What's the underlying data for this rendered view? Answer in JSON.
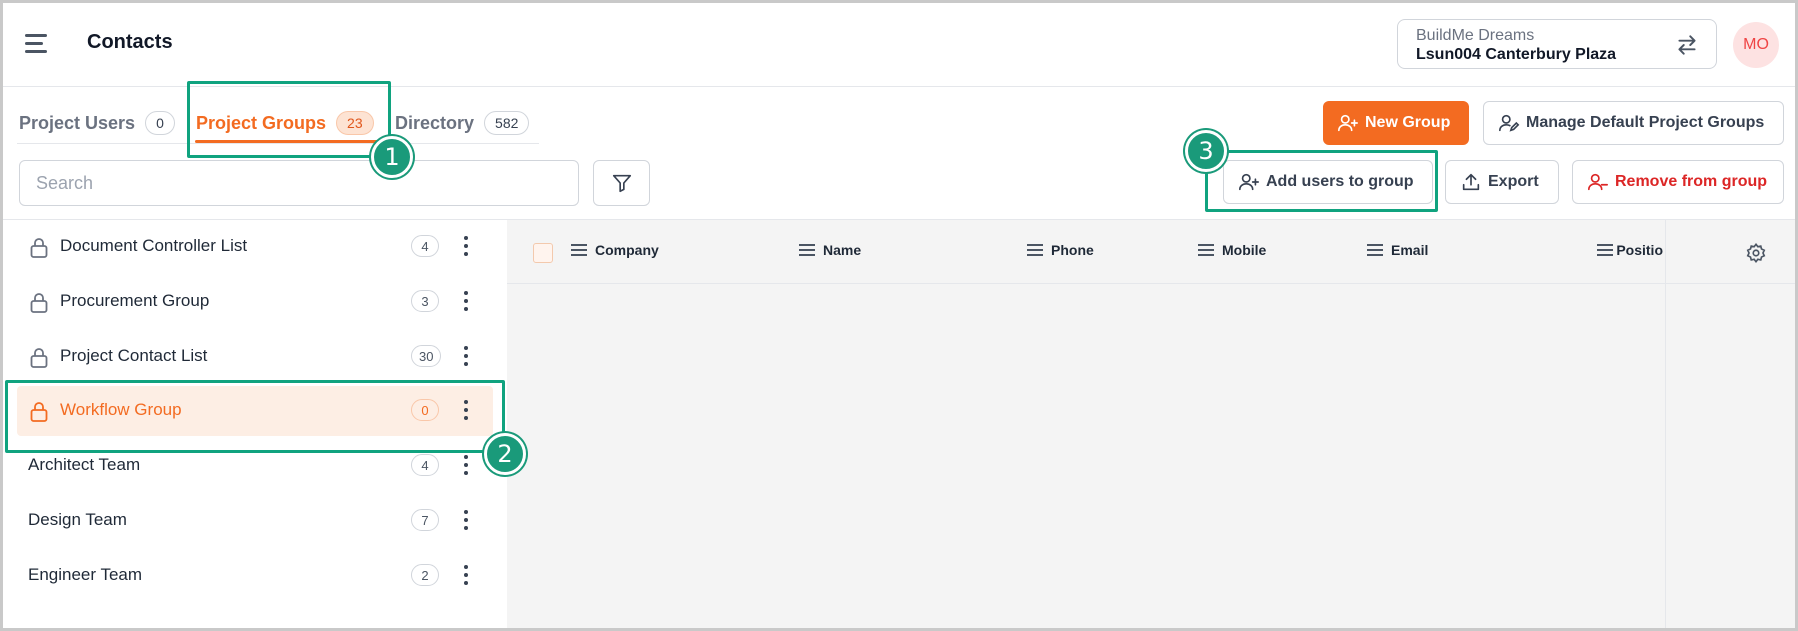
{
  "header": {
    "title": "Contacts",
    "org_name": "BuildMe Dreams",
    "project_name": "Lsun004 Canterbury Plaza",
    "avatar_initials": "MO"
  },
  "tabs": [
    {
      "label": "Project Users",
      "count": "0"
    },
    {
      "label": "Project Groups",
      "count": "23",
      "active": true
    },
    {
      "label": "Directory",
      "count": "582"
    }
  ],
  "toolbar": {
    "new_group": "New Group",
    "manage_default": "Manage Default Project Groups",
    "add_users": "Add users to group",
    "export": "Export",
    "remove_from_group": "Remove from group"
  },
  "search": {
    "placeholder": "Search"
  },
  "groups": [
    {
      "label": "Document Controller List",
      "count": "4",
      "locked": true
    },
    {
      "label": "Procurement Group",
      "count": "3",
      "locked": true
    },
    {
      "label": "Project Contact List",
      "count": "30",
      "locked": true
    },
    {
      "label": "Workflow Group",
      "count": "0",
      "locked": true,
      "selected": true
    },
    {
      "label": "Architect Team",
      "count": "4",
      "locked": false
    },
    {
      "label": "Design Team",
      "count": "7",
      "locked": false
    },
    {
      "label": "Engineer Team",
      "count": "2",
      "locked": false
    }
  ],
  "table": {
    "columns": [
      "Company",
      "Name",
      "Phone",
      "Mobile",
      "Email",
      "Positio"
    ]
  },
  "annotations": [
    "1",
    "2",
    "3"
  ],
  "colors": {
    "accent": "#f36b21",
    "annotation": "#10a37f",
    "danger": "#dc2626"
  }
}
